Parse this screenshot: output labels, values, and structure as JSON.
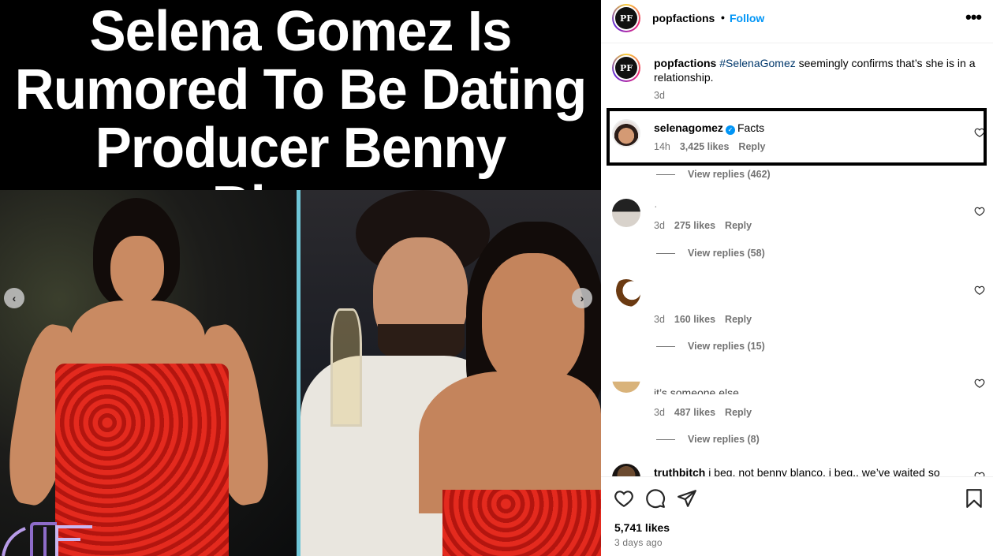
{
  "post": {
    "headline": [
      "Selena Gomez Is",
      "Rumored To Be Dating",
      "Producer Benny Blanco"
    ],
    "carousel": {
      "prev_icon": "chevron-left-icon",
      "next_icon": "chevron-right-icon"
    },
    "watermark_logo": "PF logo"
  },
  "header": {
    "username": "popfactions",
    "separator": "•",
    "follow_label": "Follow",
    "more_icon": "•••"
  },
  "caption": {
    "username": "popfactions",
    "hashtag": "#SelenaGomez",
    "text": " seemingly confirms that’s she is in a relationship.",
    "time": "3d"
  },
  "comments": [
    {
      "username": "selenagomez",
      "verified": true,
      "text": "Facts",
      "time": "14h",
      "likes": "3,425 likes",
      "reply_label": "Reply",
      "view_replies": "View replies (462)"
    },
    {
      "username": "",
      "text": "·",
      "time": "3d",
      "likes": "275 likes",
      "reply_label": "Reply",
      "view_replies": "View replies (58)"
    },
    {
      "username": "",
      "text": "",
      "time": "3d",
      "likes": "160 likes",
      "reply_label": "Reply",
      "view_replies": "View replies (15)"
    },
    {
      "username": "",
      "text": "it’s someone else",
      "time": "3d",
      "likes": "487 likes",
      "reply_label": "Reply",
      "view_replies": "View replies (8)"
    },
    {
      "username": "truthbitch",
      "text": "i beg, not benny blanco, i beg.. we’ve waited so"
    }
  ],
  "actions": {
    "like_icon": "heart-icon",
    "comment_icon": "comment-icon",
    "share_icon": "send-icon",
    "save_icon": "bookmark-icon",
    "likes": "5,741 likes",
    "date": "3 days ago"
  },
  "colors": {
    "accent_blue": "#0095f6",
    "muted": "#737373",
    "dress_red": "#d21f17",
    "divider_teal": "#6fc6d7"
  }
}
